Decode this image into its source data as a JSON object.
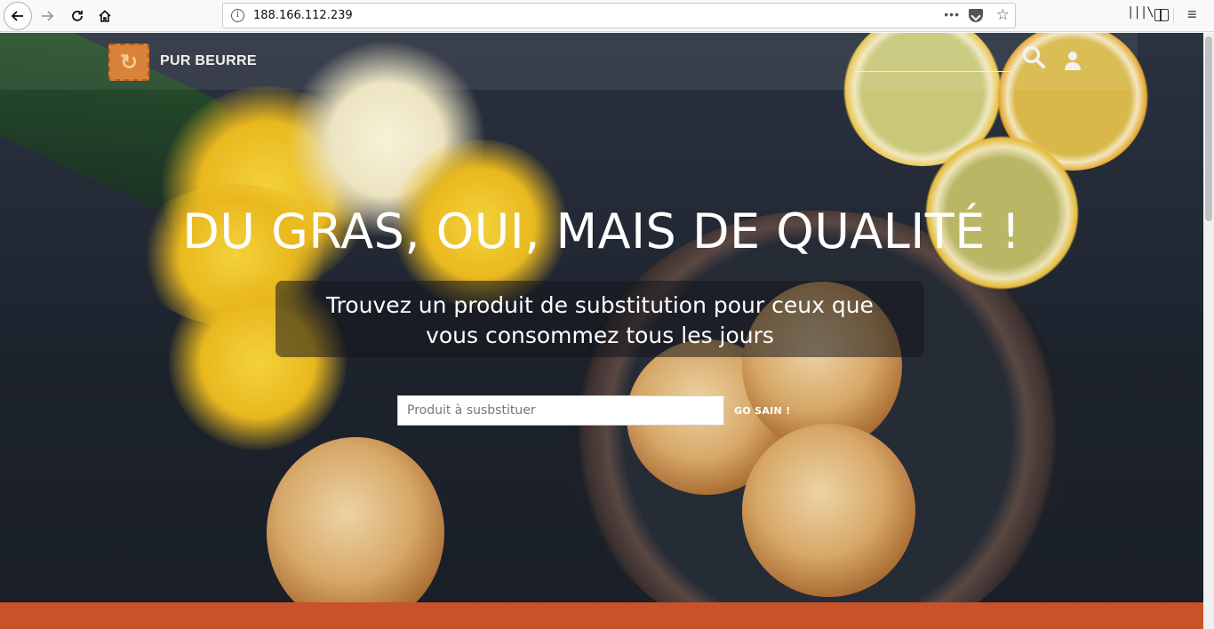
{
  "browser": {
    "url": "188.166.112.239",
    "url_info_glyph": "i",
    "url_menu_glyph": "•••",
    "star_glyph": "☆",
    "library_glyph": "|||\\",
    "menu_glyph": "≡"
  },
  "navbar": {
    "brand": "PUR BEURRE",
    "logo_glyph": "↻",
    "search_value": ""
  },
  "hero": {
    "headline": "DU GRAS, OUI, MAIS DE QUALITÉ !",
    "subtitle": "Trouvez un produit de substitution pour ceux que vous consommez tous les jours",
    "search_placeholder": "Produit à susbstituer",
    "go_label": "GO SAIN !"
  },
  "colors": {
    "accent_orange": "#c8522a",
    "logo_orange": "#d9823a"
  }
}
